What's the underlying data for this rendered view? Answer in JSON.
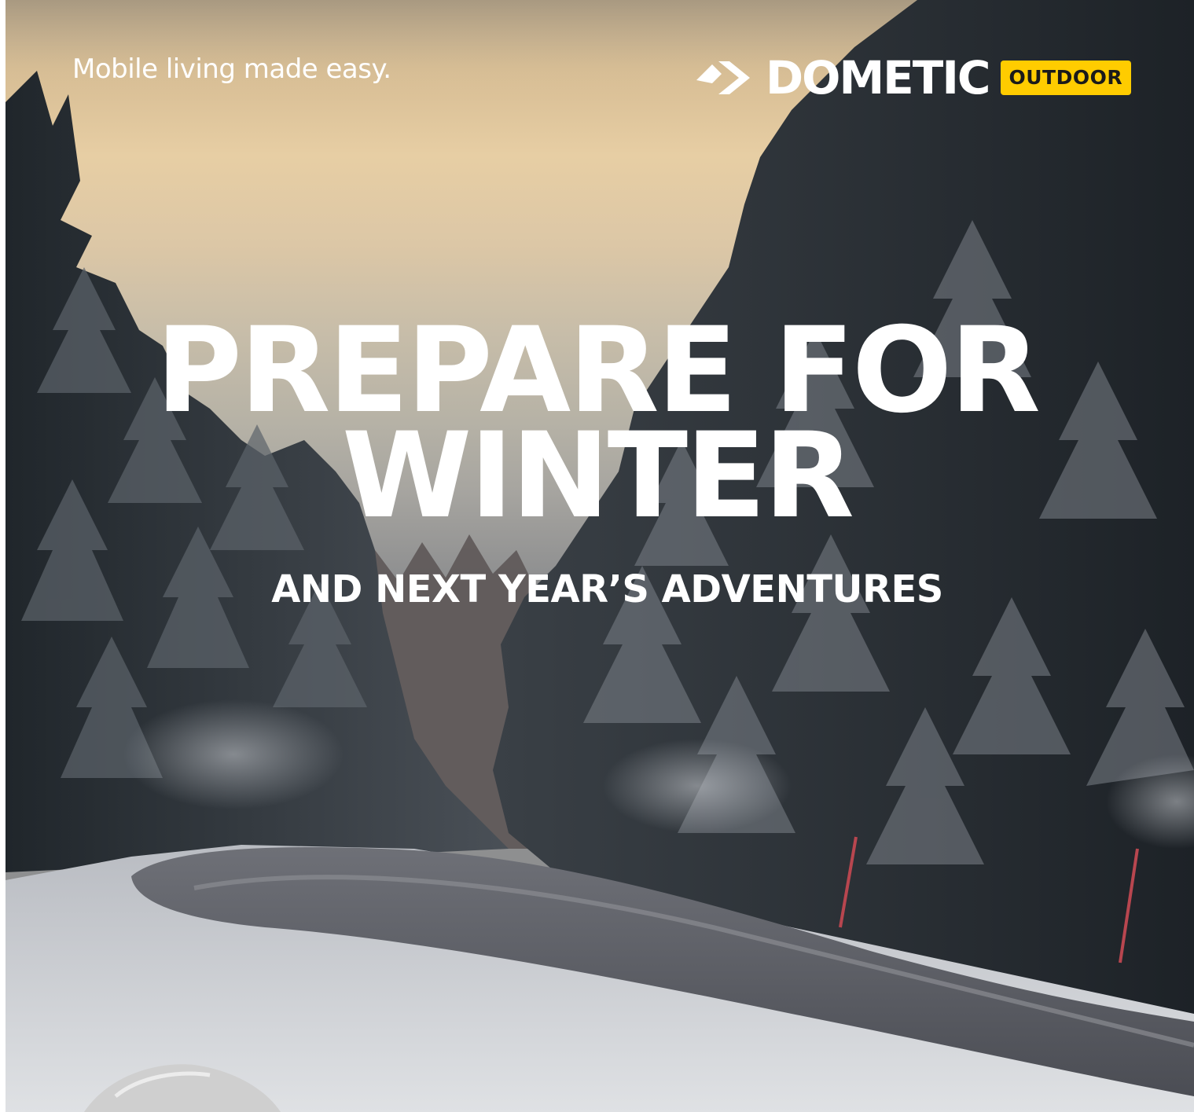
{
  "tagline": "Mobile living made easy.",
  "brand": {
    "name": "DOMETIC",
    "badge": "OUTDOOR",
    "badge_color": "#ffcc00"
  },
  "headline": {
    "line1": "PREPARE FOR",
    "line2": "WINTER"
  },
  "subheadline": "AND NEXT YEAR’S ADVENTURES",
  "scene": {
    "description_icon": "snowy-forest-road-photo"
  }
}
